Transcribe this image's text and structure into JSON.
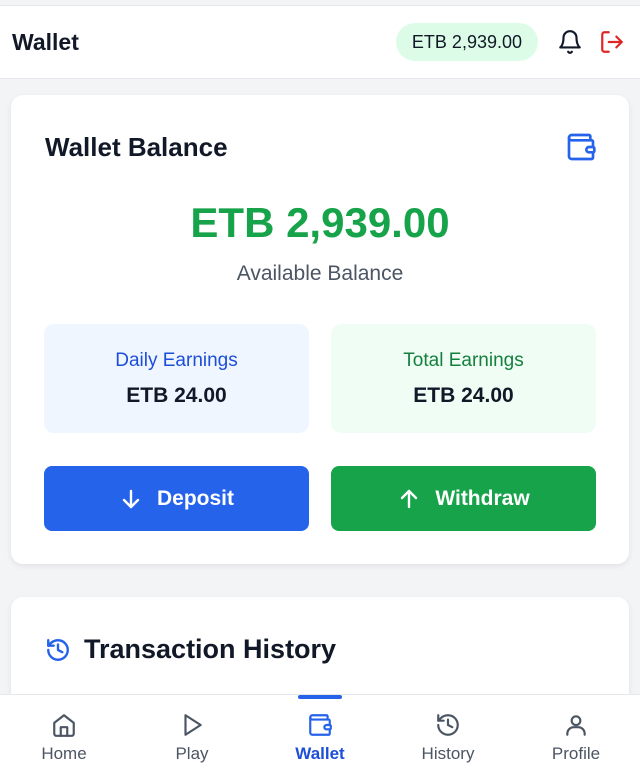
{
  "header": {
    "title": "Wallet",
    "balance_pill": "ETB 2,939.00",
    "icons": [
      "bell-icon",
      "logout-icon"
    ]
  },
  "balance_card": {
    "title": "Wallet Balance",
    "icon": "wallet-icon",
    "balance": "ETB 2,939.00",
    "balance_caption": "Available Balance",
    "daily": {
      "label": "Daily Earnings",
      "value": "ETB 24.00"
    },
    "total": {
      "label": "Total Earnings",
      "value": "ETB 24.00"
    },
    "deposit_label": "Deposit",
    "withdraw_label": "Withdraw"
  },
  "history_card": {
    "title": "Transaction History",
    "icon": "history-icon"
  },
  "nav": {
    "active": "Wallet",
    "items": [
      {
        "label": "Home",
        "icon": "home-icon"
      },
      {
        "label": "Play",
        "icon": "play-icon"
      },
      {
        "label": "Wallet",
        "icon": "wallet-icon"
      },
      {
        "label": "History",
        "icon": "history-icon"
      },
      {
        "label": "Profile",
        "icon": "user-icon"
      }
    ]
  },
  "colors": {
    "primary_blue": "#2563eb",
    "primary_green": "#16a34a",
    "danger_red": "#dc2626",
    "pill_bg": "#dcfce7"
  }
}
